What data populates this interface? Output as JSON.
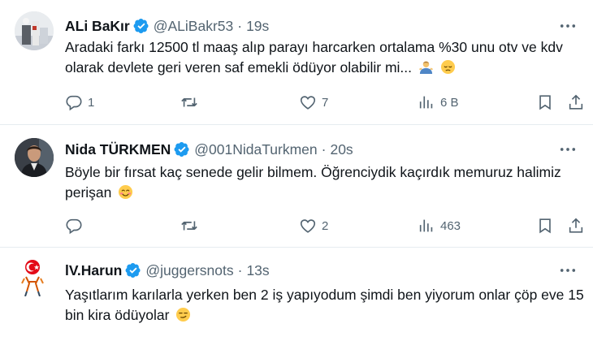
{
  "tweets": [
    {
      "name": "ALi BaKır",
      "handle": "@ALiBakr53",
      "separator": "·",
      "time": "19s",
      "text": "Aradaki farkı 12500 tl maaş alıp parayı harcarken ortalama %30 unu otv ve kdv olarak devlete geri veren saf emekli ödüyor olabilir mi...",
      "emojis": [
        "person-shrugging-emoji",
        "pensive-face-emoji"
      ],
      "replies": "1",
      "retweets": "",
      "likes": "7",
      "views": "6 B"
    },
    {
      "name": "Nida TÜRKMEN",
      "handle": "@001NidaTurkmen",
      "separator": "·",
      "time": "20s",
      "text": "Böyle bir fırsat kaç senede gelir bilmem. Öğrenciydik kaçırdık memuruz halimiz perişan",
      "emojis": [
        "smiling-face-emoji"
      ],
      "replies": "",
      "retweets": "",
      "likes": "2",
      "views": "463"
    },
    {
      "name": "lV.Harun",
      "handle": "@juggersnots",
      "separator": "·",
      "time": "13s",
      "text": "Yaşıtlarım karılarla yerken ben 2 iş yapıyodum şimdi ben yiyorum onlar çöp eve 15 bin kira ödüyolar",
      "emojis": [
        "smirking-face-emoji"
      ]
    }
  ],
  "colors": {
    "verified": "#1d9bf0",
    "muted": "#536471",
    "divider": "#e6ecf0",
    "text": "#0f1419"
  }
}
